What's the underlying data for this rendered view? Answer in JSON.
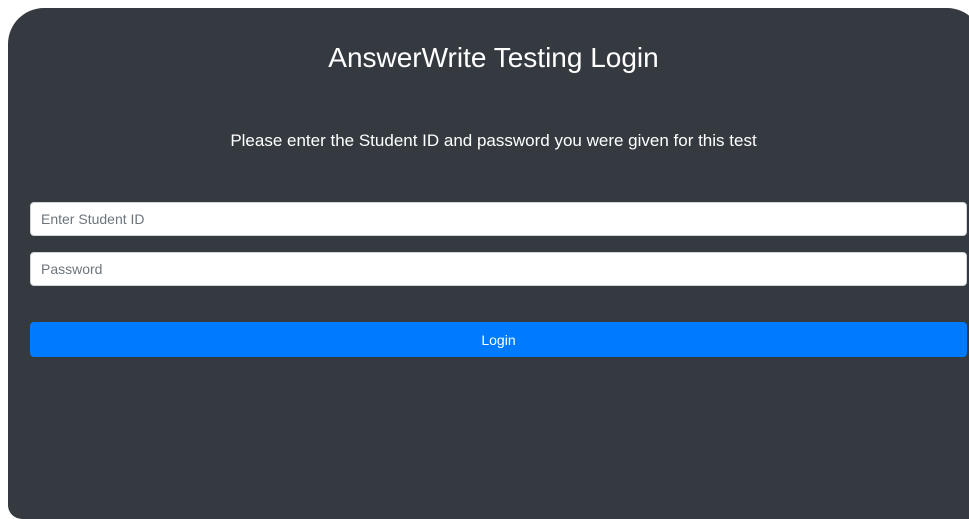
{
  "login": {
    "title": "AnswerWrite Testing Login",
    "instructions": "Please enter the Student ID and password you were given for this test",
    "student_id": {
      "value": "",
      "placeholder": "Enter Student ID"
    },
    "password": {
      "value": "",
      "placeholder": "Password"
    },
    "submit_label": "Login"
  },
  "colors": {
    "card_background": "#343a40",
    "primary_button": "#007bff",
    "text": "#ffffff"
  }
}
